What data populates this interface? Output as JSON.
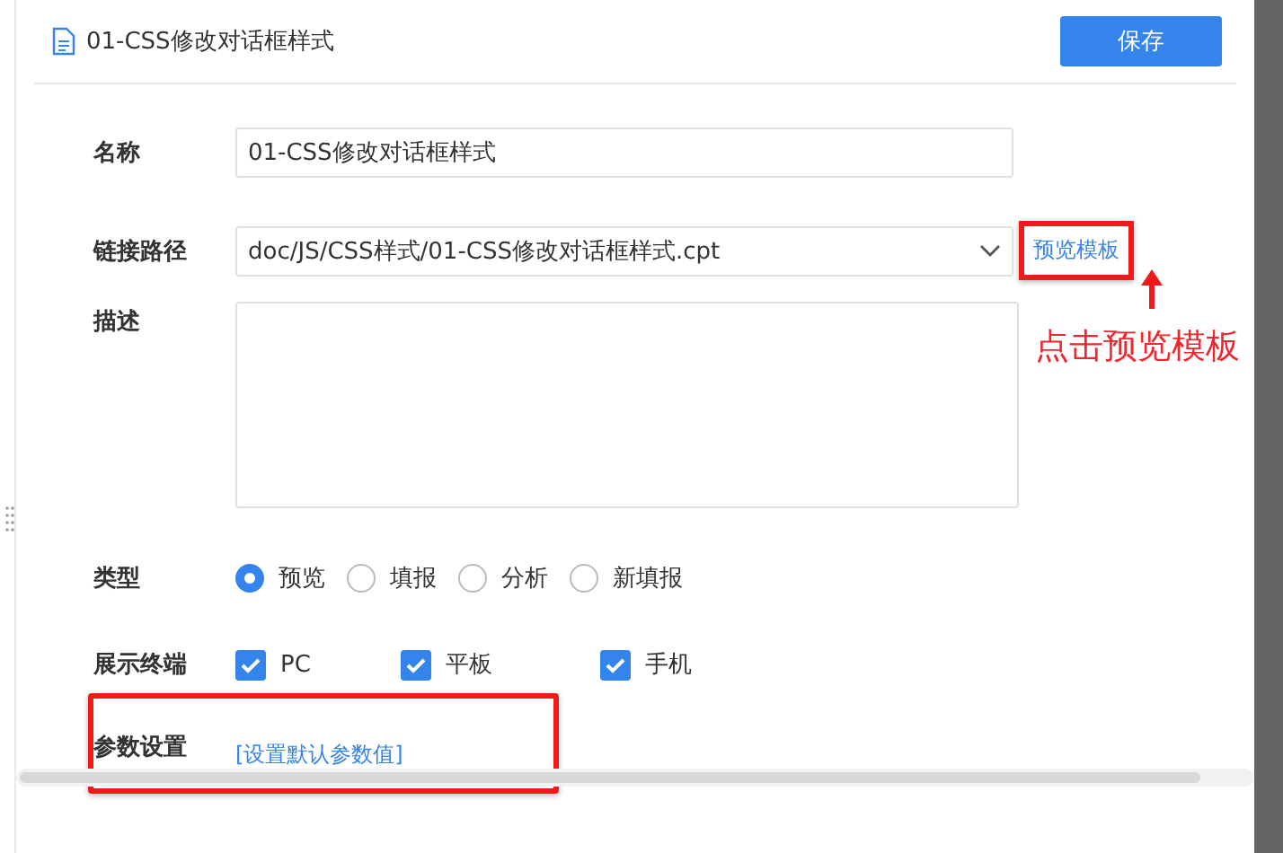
{
  "header": {
    "title": "01-CSS修改对话框样式",
    "save_button": "保存"
  },
  "fields": [
    {
      "kind": "text",
      "label": "名称",
      "value": "01-CSS修改对话框样式"
    },
    {
      "kind": "select",
      "label": "链接路径",
      "value": "doc/JS/CSS样式/01-CSS修改对话框样式.cpt",
      "link": "预览模板",
      "highlighted": true
    },
    {
      "kind": "textarea",
      "label": "描述"
    },
    {
      "kind": "radio",
      "label": "类型",
      "options": [
        {
          "label": "预览",
          "selected": true
        },
        {
          "label": "填报",
          "selected": false
        },
        {
          "label": "分析",
          "selected": false
        },
        {
          "label": "新填报",
          "selected": false
        }
      ]
    },
    {
      "kind": "checkbox",
      "label": "展示终端",
      "options": [
        {
          "label": "PC",
          "checked": true
        },
        {
          "label": "平板",
          "checked": true
        },
        {
          "label": "手机",
          "checked": true
        }
      ]
    },
    {
      "kind": "link",
      "label": "参数设置",
      "link": "[设置默认参数值]",
      "highlighted": true
    }
  ],
  "callout": "点击预览模板"
}
